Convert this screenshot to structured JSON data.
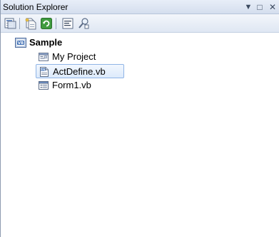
{
  "window": {
    "title": "Solution Explorer",
    "menu_glyph": "▼",
    "maximize_glyph": "□",
    "close_glyph": "✕"
  },
  "toolbar": {
    "buttons": [
      {
        "icon": "properties-icon"
      },
      {
        "icon": "show-all-files-icon"
      },
      {
        "icon": "refresh-icon"
      },
      {
        "icon": "view-code-icon"
      },
      {
        "icon": "class-diagram-icon"
      }
    ]
  },
  "tree": {
    "root": {
      "label": "Sample",
      "icon": "vb-project-icon"
    },
    "items": [
      {
        "label": "My Project",
        "icon": "my-project-icon",
        "selected": false
      },
      {
        "label": "ActDefine.vb",
        "icon": "vb-module-icon",
        "selected": true
      },
      {
        "label": "Form1.vb",
        "icon": "vb-form-icon",
        "selected": false
      }
    ]
  }
}
